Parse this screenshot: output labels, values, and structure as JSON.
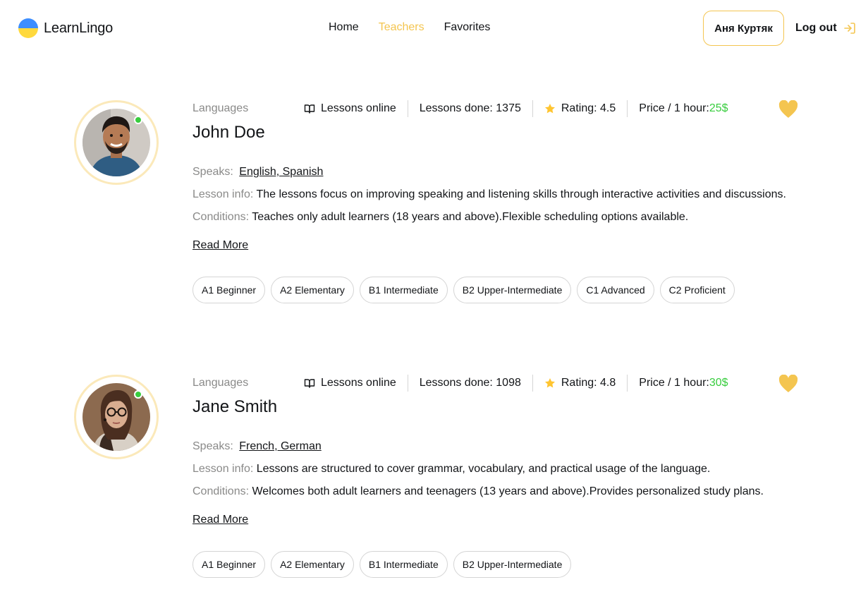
{
  "header": {
    "logo_text": "LearnLingo",
    "nav": [
      {
        "label": "Home",
        "active": false
      },
      {
        "label": "Teachers",
        "active": true
      },
      {
        "label": "Favorites",
        "active": false
      }
    ],
    "user_name": "Аня Куртяк",
    "logout_label": "Log out"
  },
  "colors": {
    "accent": "#f4c550",
    "price": "#38cd3e",
    "muted": "#8a8a89",
    "online": "#38cd3e"
  },
  "teachers": [
    {
      "languages_label": "Languages",
      "name": "John Doe",
      "stat_online": "Lessons online",
      "stat_done": "Lessons done: 1375",
      "stat_rating": "Rating: 4.5",
      "price_label": "Price / 1 hour: ",
      "price_value": "25$",
      "speaks_label": "Speaks:",
      "speaks_value": "English,  Spanish",
      "info_label": "Lesson info:",
      "info_value": " The lessons focus on improving speaking and listening skills through interactive activities and discussions.",
      "conditions_label": "Conditions:",
      "conditions_value": " Teaches only adult learners (18 years and above).Flexible scheduling options available.",
      "read_more": "Read More",
      "levels": [
        "A1 Beginner",
        "A2 Elementary",
        "B1 Intermediate",
        "B2 Upper-Intermediate",
        "C1 Advanced",
        "C2 Proficient"
      ]
    },
    {
      "languages_label": "Languages",
      "name": "Jane Smith",
      "stat_online": "Lessons online",
      "stat_done": "Lessons done: 1098",
      "stat_rating": "Rating: 4.8",
      "price_label": "Price / 1 hour: ",
      "price_value": "30$",
      "speaks_label": "Speaks:",
      "speaks_value": "French,  German",
      "info_label": "Lesson info:",
      "info_value": " Lessons are structured to cover grammar, vocabulary, and practical usage of the language.",
      "conditions_label": "Conditions:",
      "conditions_value": " Welcomes both adult learners and teenagers (13 years and above).Provides personalized study plans.",
      "read_more": "Read More",
      "levels": [
        "A1 Beginner",
        "A2 Elementary",
        "B1 Intermediate",
        "B2 Upper-Intermediate"
      ]
    }
  ]
}
